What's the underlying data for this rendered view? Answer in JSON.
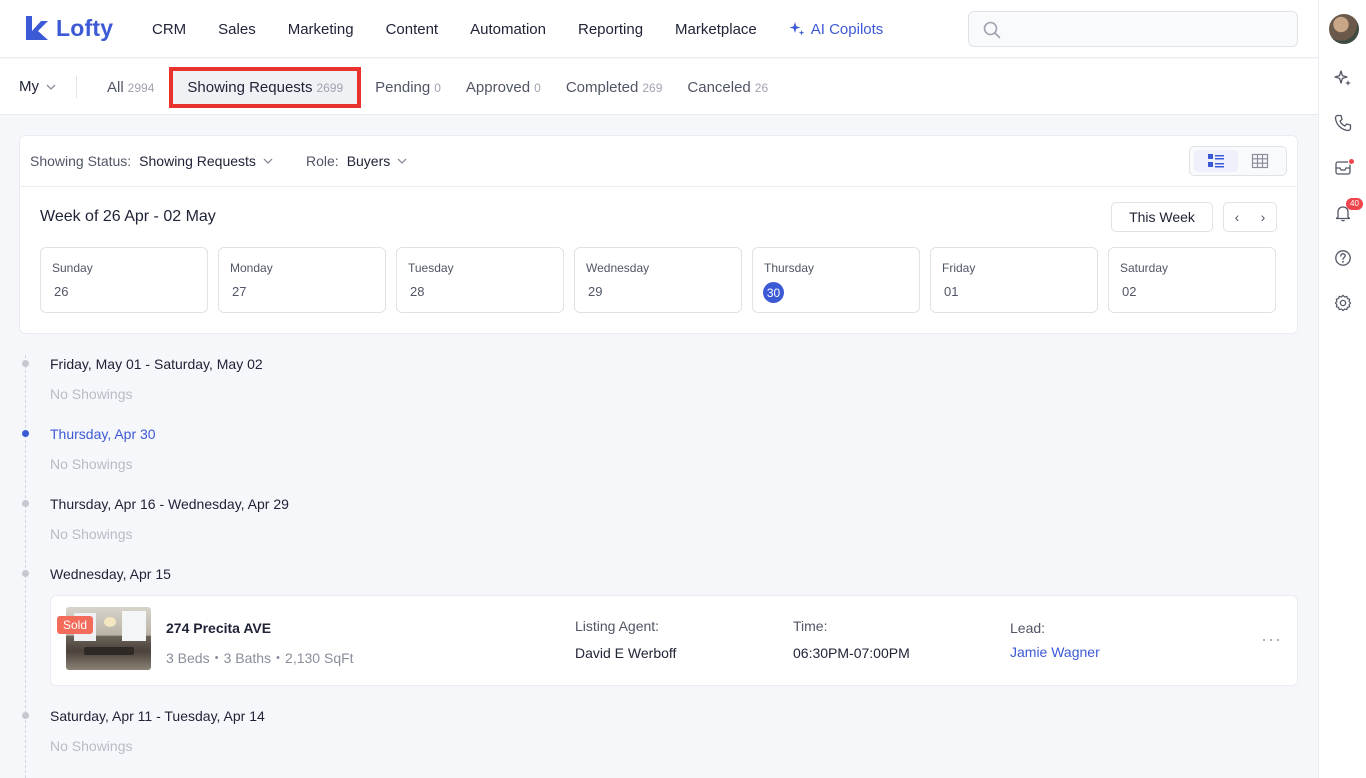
{
  "brand": {
    "name": "Lofty",
    "color": "#3d5ad6"
  },
  "nav": {
    "items": [
      "CRM",
      "Sales",
      "Marketing",
      "Content",
      "Automation",
      "Reporting",
      "Marketplace"
    ],
    "ai_label": "AI Copilots"
  },
  "search": {
    "placeholder": ""
  },
  "rail": {
    "notification_count": "40"
  },
  "tabs": {
    "scope": "My",
    "items": [
      {
        "label": "All",
        "count": "2994"
      },
      {
        "label": "Showing Requests",
        "count": "2699"
      },
      {
        "label": "Pending",
        "count": "0"
      },
      {
        "label": "Approved",
        "count": "0"
      },
      {
        "label": "Completed",
        "count": "269"
      },
      {
        "label": "Canceled",
        "count": "26"
      }
    ]
  },
  "filters": {
    "status_label": "Showing Status:",
    "status_value": "Showing Requests",
    "role_label": "Role:",
    "role_value": "Buyers"
  },
  "week": {
    "title": "Week of 26 Apr - 02 May",
    "this_week_label": "This Week",
    "prev": "‹",
    "next": "›",
    "days": [
      {
        "name": "Sunday",
        "num": "26"
      },
      {
        "name": "Monday",
        "num": "27"
      },
      {
        "name": "Tuesday",
        "num": "28"
      },
      {
        "name": "Wednesday",
        "num": "29"
      },
      {
        "name": "Thursday",
        "num": "30"
      },
      {
        "name": "Friday",
        "num": "01"
      },
      {
        "name": "Saturday",
        "num": "02"
      }
    ]
  },
  "timeline": {
    "no_showings": "No Showings",
    "groups": [
      "Friday, May 01 - Saturday, May 02",
      "Thursday, Apr 30",
      "Thursday, Apr 16 - Wednesday, Apr 29",
      "Wednesday, Apr 15",
      "Saturday, Apr 11 - Tuesday, Apr 14"
    ]
  },
  "showing": {
    "badge": "Sold",
    "address": "274 Precita AVE",
    "specs": "3 Beds・3 Baths・2,130 SqFt",
    "agent_label": "Listing Agent:",
    "agent": "David E Werboff",
    "time_label": "Time:",
    "time": "06:30PM-07:00PM",
    "lead_label": "Lead:",
    "lead": "Jamie Wagner",
    "more": "···"
  }
}
